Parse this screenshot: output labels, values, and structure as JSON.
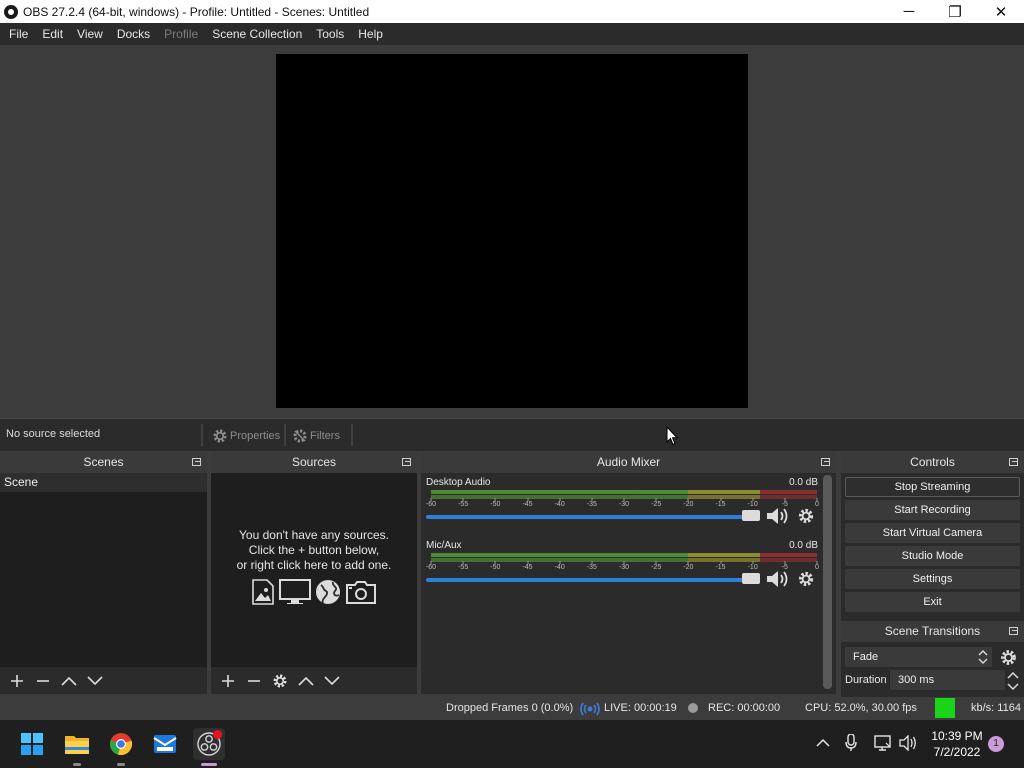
{
  "window": {
    "title": "OBS 27.2.4 (64-bit, windows) - Profile: Untitled - Scenes: Untitled",
    "minimize_glyph": "─",
    "maximize_glyph": "❐",
    "close_glyph": "✕"
  },
  "menu": [
    "File",
    "Edit",
    "View",
    "Docks",
    "Profile",
    "Scene Collection",
    "Tools",
    "Help"
  ],
  "source_toolbar": {
    "status": "No source selected",
    "properties_label": "Properties",
    "filters_label": "Filters"
  },
  "scenes": {
    "title": "Scenes",
    "items": [
      "Scene"
    ]
  },
  "sources": {
    "title": "Sources",
    "empty_line1": "You don't have any sources.",
    "empty_line2": "Click the + button below,",
    "empty_line3": "or right click here to add one."
  },
  "mixer": {
    "title": "Audio Mixer",
    "scale": [
      "-60",
      "-55",
      "-50",
      "-45",
      "-40",
      "-35",
      "-30",
      "-25",
      "-20",
      "-15",
      "-10",
      "-5",
      "0"
    ],
    "tracks": [
      {
        "name": "Desktop Audio",
        "db": "0.0 dB",
        "volume": 1.0
      },
      {
        "name": "Mic/Aux",
        "db": "0.0 dB",
        "volume": 1.0
      }
    ]
  },
  "controls": {
    "title": "Controls",
    "buttons": [
      "Stop Streaming",
      "Start Recording",
      "Start Virtual Camera",
      "Studio Mode",
      "Settings",
      "Exit"
    ]
  },
  "transitions": {
    "title": "Scene Transitions",
    "selected": "Fade",
    "duration_label": "Duration",
    "duration_value": "300 ms"
  },
  "status": {
    "dropped_frames": "Dropped Frames 0 (0.0%)",
    "live": "LIVE: 00:00:19",
    "rec": "REC: 00:00:00",
    "cpu": "CPU: 52.0%, 30.00 fps",
    "kbs": "kb/s: 1164",
    "health_color": "#19d419"
  },
  "taskbar": {
    "apps": [
      "start-icon",
      "file-explorer-icon",
      "chrome-icon",
      "mail-icon",
      "obs-icon"
    ],
    "time": "10:39 PM",
    "date": "7/2/2022",
    "notifications": "1"
  }
}
